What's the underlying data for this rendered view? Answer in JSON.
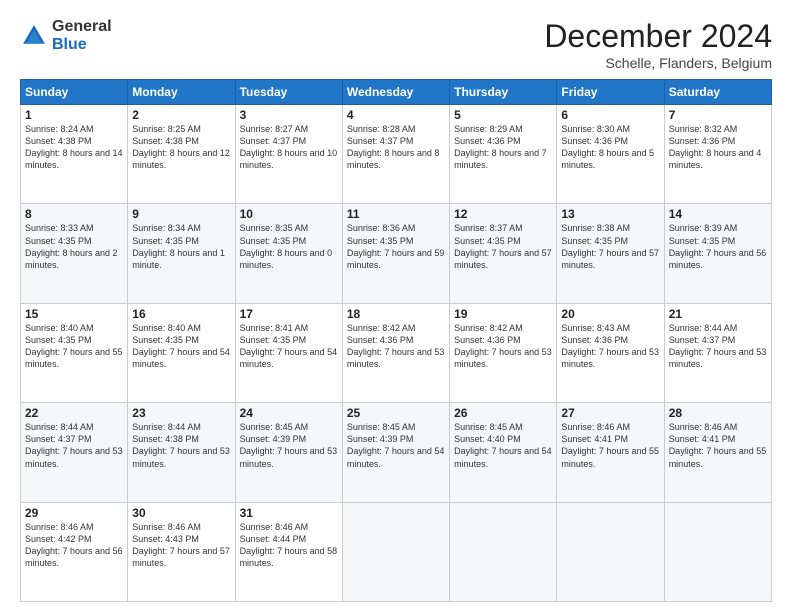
{
  "logo": {
    "general": "General",
    "blue": "Blue"
  },
  "title": "December 2024",
  "location": "Schelle, Flanders, Belgium",
  "days_of_week": [
    "Sunday",
    "Monday",
    "Tuesday",
    "Wednesday",
    "Thursday",
    "Friday",
    "Saturday"
  ],
  "weeks": [
    [
      {
        "day": "1",
        "sunrise": "8:24 AM",
        "sunset": "4:38 PM",
        "daylight": "8 hours and 14 minutes."
      },
      {
        "day": "2",
        "sunrise": "8:25 AM",
        "sunset": "4:38 PM",
        "daylight": "8 hours and 12 minutes."
      },
      {
        "day": "3",
        "sunrise": "8:27 AM",
        "sunset": "4:37 PM",
        "daylight": "8 hours and 10 minutes."
      },
      {
        "day": "4",
        "sunrise": "8:28 AM",
        "sunset": "4:37 PM",
        "daylight": "8 hours and 8 minutes."
      },
      {
        "day": "5",
        "sunrise": "8:29 AM",
        "sunset": "4:36 PM",
        "daylight": "8 hours and 7 minutes."
      },
      {
        "day": "6",
        "sunrise": "8:30 AM",
        "sunset": "4:36 PM",
        "daylight": "8 hours and 5 minutes."
      },
      {
        "day": "7",
        "sunrise": "8:32 AM",
        "sunset": "4:36 PM",
        "daylight": "8 hours and 4 minutes."
      }
    ],
    [
      {
        "day": "8",
        "sunrise": "8:33 AM",
        "sunset": "4:35 PM",
        "daylight": "8 hours and 2 minutes."
      },
      {
        "day": "9",
        "sunrise": "8:34 AM",
        "sunset": "4:35 PM",
        "daylight": "8 hours and 1 minute."
      },
      {
        "day": "10",
        "sunrise": "8:35 AM",
        "sunset": "4:35 PM",
        "daylight": "8 hours and 0 minutes."
      },
      {
        "day": "11",
        "sunrise": "8:36 AM",
        "sunset": "4:35 PM",
        "daylight": "7 hours and 59 minutes."
      },
      {
        "day": "12",
        "sunrise": "8:37 AM",
        "sunset": "4:35 PM",
        "daylight": "7 hours and 57 minutes."
      },
      {
        "day": "13",
        "sunrise": "8:38 AM",
        "sunset": "4:35 PM",
        "daylight": "7 hours and 57 minutes."
      },
      {
        "day": "14",
        "sunrise": "8:39 AM",
        "sunset": "4:35 PM",
        "daylight": "7 hours and 56 minutes."
      }
    ],
    [
      {
        "day": "15",
        "sunrise": "8:40 AM",
        "sunset": "4:35 PM",
        "daylight": "7 hours and 55 minutes."
      },
      {
        "day": "16",
        "sunrise": "8:40 AM",
        "sunset": "4:35 PM",
        "daylight": "7 hours and 54 minutes."
      },
      {
        "day": "17",
        "sunrise": "8:41 AM",
        "sunset": "4:35 PM",
        "daylight": "7 hours and 54 minutes."
      },
      {
        "day": "18",
        "sunrise": "8:42 AM",
        "sunset": "4:36 PM",
        "daylight": "7 hours and 53 minutes."
      },
      {
        "day": "19",
        "sunrise": "8:42 AM",
        "sunset": "4:36 PM",
        "daylight": "7 hours and 53 minutes."
      },
      {
        "day": "20",
        "sunrise": "8:43 AM",
        "sunset": "4:36 PM",
        "daylight": "7 hours and 53 minutes."
      },
      {
        "day": "21",
        "sunrise": "8:44 AM",
        "sunset": "4:37 PM",
        "daylight": "7 hours and 53 minutes."
      }
    ],
    [
      {
        "day": "22",
        "sunrise": "8:44 AM",
        "sunset": "4:37 PM",
        "daylight": "7 hours and 53 minutes."
      },
      {
        "day": "23",
        "sunrise": "8:44 AM",
        "sunset": "4:38 PM",
        "daylight": "7 hours and 53 minutes."
      },
      {
        "day": "24",
        "sunrise": "8:45 AM",
        "sunset": "4:39 PM",
        "daylight": "7 hours and 53 minutes."
      },
      {
        "day": "25",
        "sunrise": "8:45 AM",
        "sunset": "4:39 PM",
        "daylight": "7 hours and 54 minutes."
      },
      {
        "day": "26",
        "sunrise": "8:45 AM",
        "sunset": "4:40 PM",
        "daylight": "7 hours and 54 minutes."
      },
      {
        "day": "27",
        "sunrise": "8:46 AM",
        "sunset": "4:41 PM",
        "daylight": "7 hours and 55 minutes."
      },
      {
        "day": "28",
        "sunrise": "8:46 AM",
        "sunset": "4:41 PM",
        "daylight": "7 hours and 55 minutes."
      }
    ],
    [
      {
        "day": "29",
        "sunrise": "8:46 AM",
        "sunset": "4:42 PM",
        "daylight": "7 hours and 56 minutes."
      },
      {
        "day": "30",
        "sunrise": "8:46 AM",
        "sunset": "4:43 PM",
        "daylight": "7 hours and 57 minutes."
      },
      {
        "day": "31",
        "sunrise": "8:46 AM",
        "sunset": "4:44 PM",
        "daylight": "7 hours and 58 minutes."
      },
      null,
      null,
      null,
      null
    ]
  ]
}
